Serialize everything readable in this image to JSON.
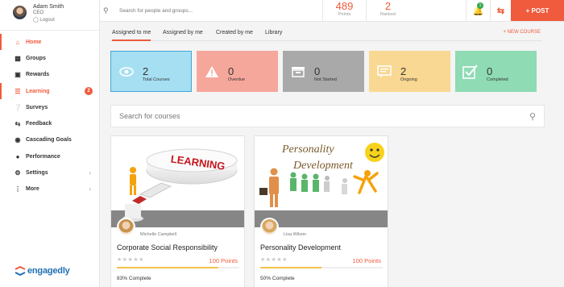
{
  "user": {
    "name": "Adam Smith",
    "role": "CEO",
    "logout": "Logout"
  },
  "search": {
    "placeholder": "Search for people and groups..."
  },
  "stats": {
    "points": "489",
    "points_label": "Points",
    "ranked": "2",
    "ranked_label": "Ranked"
  },
  "notifications": {
    "count": "1"
  },
  "post_button": "+ POST",
  "nav": [
    {
      "label": "Home",
      "icon": "home-icon",
      "active": true
    },
    {
      "label": "Groups",
      "icon": "groups-icon"
    },
    {
      "label": "Rewards",
      "icon": "gift-icon"
    },
    {
      "label": "Learning",
      "icon": "book-icon",
      "badge": "2"
    },
    {
      "label": "Surveys",
      "icon": "question-icon"
    },
    {
      "label": "Feedback",
      "icon": "feedback-icon"
    },
    {
      "label": "Cascading Goals",
      "icon": "goals-icon"
    },
    {
      "label": "Performance",
      "icon": "performance-icon"
    },
    {
      "label": "Settings",
      "icon": "gear-icon",
      "chevron": true
    },
    {
      "label": "More",
      "icon": "more-icon",
      "chevron": true
    }
  ],
  "logo": "engagedly",
  "tabs": [
    "Assigned to me",
    "Assigned by me",
    "Created by me",
    "Library"
  ],
  "new_course": "+ NEW COURSE",
  "summary": [
    {
      "value": "2",
      "label": "Total Courses",
      "color": "#a6dff2",
      "icon": "eye-icon"
    },
    {
      "value": "0",
      "label": "Overdue",
      "color": "#f6a79c",
      "icon": "warning-icon"
    },
    {
      "value": "0",
      "label": "Not Started",
      "color": "#a9a9a9",
      "icon": "box-icon"
    },
    {
      "value": "2",
      "label": "Ongoing",
      "color": "#f9d893",
      "icon": "chat-icon"
    },
    {
      "value": "0",
      "label": "Completed",
      "color": "#8fdbb4",
      "icon": "check-icon"
    }
  ],
  "course_search": {
    "placeholder": "Search for courses"
  },
  "courses": [
    {
      "author": "Michelle Campbell",
      "title": "Corporate Social Responsibility",
      "points": "100 Points",
      "progress": 83,
      "complete": "83% Complete",
      "image_text": "LEARNING"
    },
    {
      "author": "Lisa Wilson",
      "title": "Personality Development",
      "points": "100 Points",
      "progress": 50,
      "complete": "50% Complete",
      "image_text_1": "Personality",
      "image_text_2": "Development"
    }
  ],
  "accent": "#ef5b3c"
}
